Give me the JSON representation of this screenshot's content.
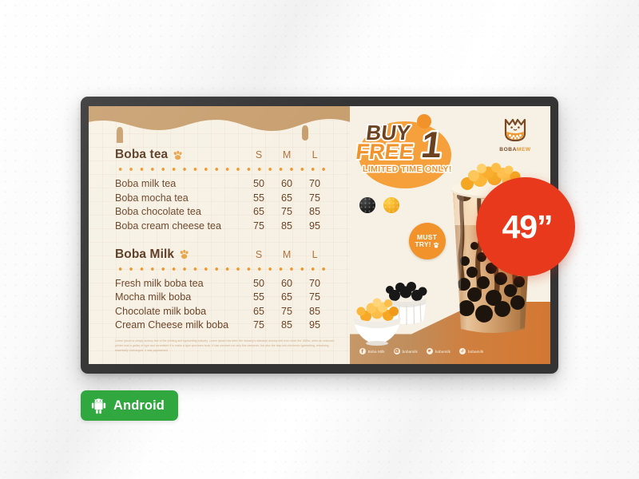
{
  "background": {
    "base_color": "#fafafa",
    "dot_pattern": true
  },
  "monitor": {
    "bezel_color": "#343434",
    "screen_bg": "#f7f1e5"
  },
  "menu": {
    "sections": [
      {
        "title": "Boba tea",
        "icon": "paw-print-icon",
        "size_headers": [
          "S",
          "M",
          "L"
        ],
        "items": [
          {
            "name": "Boba milk tea",
            "prices": [
              "50",
              "60",
              "70"
            ]
          },
          {
            "name": "Boba mocha tea",
            "prices": [
              "55",
              "65",
              "75"
            ]
          },
          {
            "name": "Boba chocolate tea",
            "prices": [
              "65",
              "75",
              "85"
            ]
          },
          {
            "name": "Boba cream cheese tea",
            "prices": [
              "75",
              "85",
              "95"
            ]
          }
        ]
      },
      {
        "title": "Boba Milk",
        "icon": "paw-print-icon",
        "size_headers": [
          "S",
          "M",
          "L"
        ],
        "items": [
          {
            "name": "Fresh milk boba tea",
            "prices": [
              "50",
              "60",
              "70"
            ]
          },
          {
            "name": "Mocha milk boba",
            "prices": [
              "55",
              "65",
              "75"
            ]
          },
          {
            "name": "Chocolate milk boba",
            "prices": [
              "65",
              "75",
              "85"
            ]
          },
          {
            "name": "Cream Cheese milk boba",
            "prices": [
              "75",
              "85",
              "95"
            ]
          }
        ]
      }
    ],
    "footer_text": "Lorem Ipsum is simply dummy text of the printing and typesetting industry. Lorem Ipsum has been the industry's standard dummy text ever since the 1500s, when an unknown printer took a galley of type and scrambled it to make a type specimen book. It has survived not only five centuries, but also the leap into electronic typesetting, remaining essentially unchanged. It was popularised."
  },
  "promo": {
    "offer": {
      "line1": "BUY",
      "line2": "FREE",
      "number": "1",
      "subtitle": "LIMITED TIME ONLY!"
    },
    "must_try": {
      "line1": "MUST",
      "line2": "TRY!",
      "icon": "paw-print-icon"
    },
    "logo": {
      "icon": "cat-boba-cup-icon",
      "name_primary": "BOBA",
      "name_accent": "MEW",
      "primary_color": "#7a4a25",
      "accent_color": "#f0972c"
    },
    "socials": [
      {
        "icon": "facebook-icon",
        "label": "Boba Milk"
      },
      {
        "icon": "instagram-icon",
        "label": "bobamilk"
      },
      {
        "icon": "twitter-icon",
        "label": "bobamilk"
      },
      {
        "icon": "tiktok-icon",
        "label": "bobamilk"
      }
    ]
  },
  "size_badge": {
    "label": "49”",
    "color": "#e8391c"
  },
  "platform_badge": {
    "icon": "android-robot-icon",
    "label": "Android",
    "color": "#31a83f"
  }
}
